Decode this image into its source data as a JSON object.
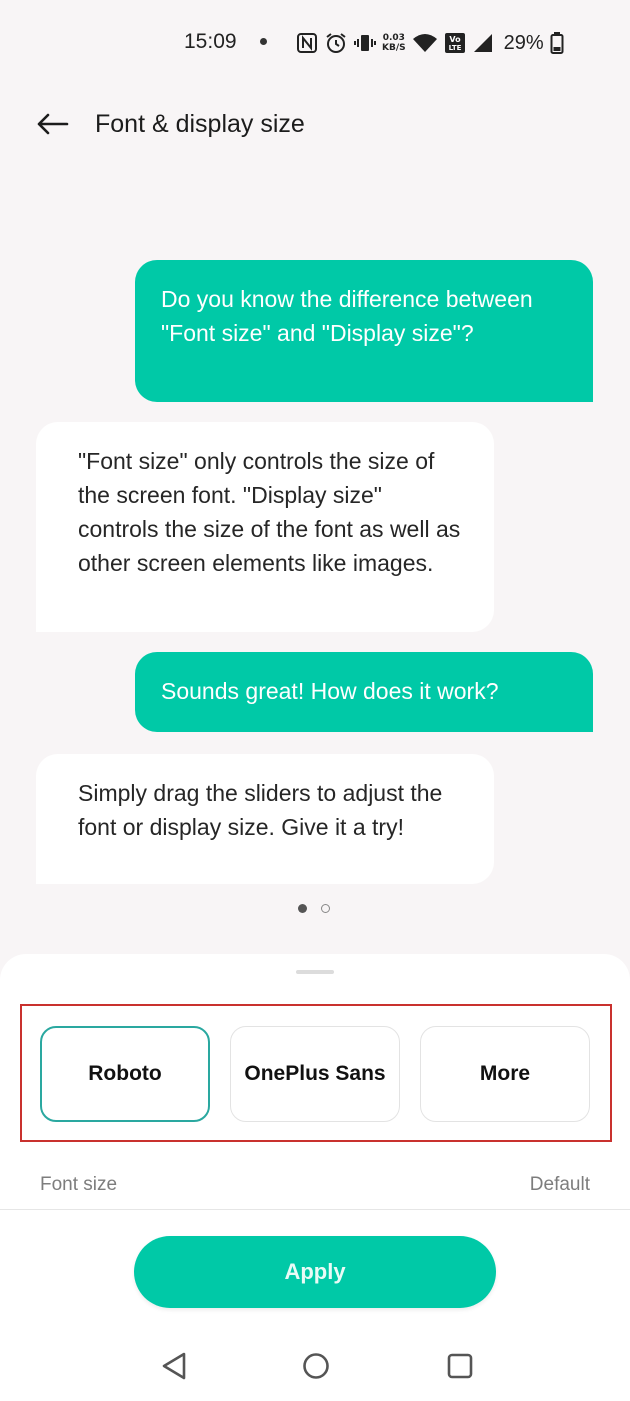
{
  "status_bar": {
    "time": "15:09",
    "net_speed_value": "0.03",
    "net_speed_unit": "KB/S",
    "volte_label": "Vo LTE",
    "battery": "29%"
  },
  "header": {
    "title": "Font & display size"
  },
  "chat": [
    {
      "from": "user",
      "text": "Do you know the difference between \"Font size\" and \"Display size\"?"
    },
    {
      "from": "bot",
      "text": "\"Font size\" only controls the size of the screen font. \"Display size\" controls the size of the font as well as other screen elements like images."
    },
    {
      "from": "user",
      "text": "Sounds great! How does it work?"
    },
    {
      "from": "bot",
      "text": "Simply drag the sliders to adjust the font or display size. Give it a try!"
    }
  ],
  "font_options": [
    {
      "label": "Roboto",
      "selected": true
    },
    {
      "label": "OnePlus Sans",
      "selected": false
    },
    {
      "label": "More",
      "selected": false
    }
  ],
  "font_size": {
    "label": "Font size",
    "value": "Default"
  },
  "apply_label": "Apply",
  "colors": {
    "accent": "#00c9a7",
    "selected_border": "#2aa8a0",
    "highlight_box": "#c9312e"
  }
}
